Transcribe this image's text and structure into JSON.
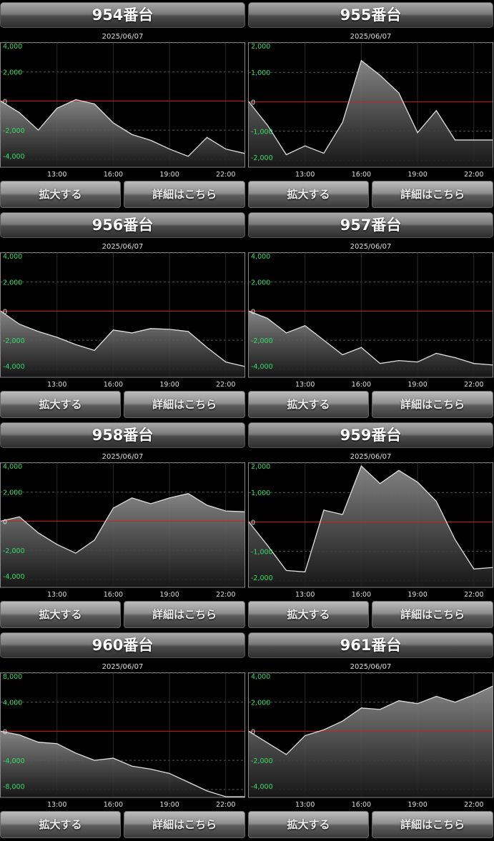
{
  "buttons": {
    "zoom_label": "拡大する",
    "detail_label": "詳細はこちら"
  },
  "colors": {
    "zero_line": "#cc2222",
    "axis_label": "#33dd66",
    "line": "#e0e0e0",
    "grid": "#555555"
  },
  "panels": [
    {
      "title": "954番台",
      "date": "2025/06/07"
    },
    {
      "title": "955番台",
      "date": "2025/06/07"
    },
    {
      "title": "956番台",
      "date": "2025/06/07"
    },
    {
      "title": "957番台",
      "date": "2025/06/07"
    },
    {
      "title": "958番台",
      "date": "2025/06/07"
    },
    {
      "title": "959番台",
      "date": "2025/06/07"
    },
    {
      "title": "960番台",
      "date": "2025/06/07"
    },
    {
      "title": "961番台",
      "date": "2025/06/07"
    }
  ],
  "chart_data": [
    {
      "type": "area",
      "x": [
        "10:00",
        "11:00",
        "12:00",
        "13:00",
        "14:00",
        "15:00",
        "16:00",
        "17:00",
        "18:00",
        "19:00",
        "20:00",
        "21:00",
        "22:00",
        "23:00"
      ],
      "xticks": [
        "13:00",
        "16:00",
        "19:00",
        "22:00"
      ],
      "ylim": [
        -4500,
        4000
      ],
      "yticks": [
        4000,
        2000,
        0,
        -2000,
        -4000
      ],
      "ytick_labels": [
        "4,000",
        "2,000",
        "0",
        "-2,000",
        "-4,000"
      ],
      "values": [
        0,
        -800,
        -2000,
        -500,
        100,
        -200,
        -1500,
        -2300,
        -2700,
        -3300,
        -3800,
        -2500,
        -3300,
        -3600
      ]
    },
    {
      "type": "area",
      "x": [
        "10:00",
        "11:00",
        "12:00",
        "13:00",
        "14:00",
        "15:00",
        "16:00",
        "17:00",
        "18:00",
        "19:00",
        "20:00",
        "21:00",
        "22:00",
        "23:00"
      ],
      "xticks": [
        "13:00",
        "16:00",
        "19:00",
        "22:00"
      ],
      "ylim": [
        -2200,
        2000
      ],
      "yticks": [
        2000,
        1000,
        0,
        -1000,
        -2000
      ],
      "ytick_labels": [
        "2,000",
        "1,000",
        "0",
        "-1,000",
        "-2,000"
      ],
      "values": [
        0,
        -800,
        -1800,
        -1500,
        -1750,
        -700,
        1400,
        900,
        300,
        -1050,
        -300,
        -1300,
        -1300,
        -1300
      ]
    },
    {
      "type": "area",
      "x": [
        "10:00",
        "11:00",
        "12:00",
        "13:00",
        "14:00",
        "15:00",
        "16:00",
        "17:00",
        "18:00",
        "19:00",
        "20:00",
        "21:00",
        "22:00",
        "23:00"
      ],
      "xticks": [
        "13:00",
        "16:00",
        "19:00",
        "22:00"
      ],
      "ylim": [
        -4500,
        4000
      ],
      "yticks": [
        4000,
        2000,
        0,
        -2000,
        -4000
      ],
      "ytick_labels": [
        "4,000",
        "2,000",
        "0",
        "-2,000",
        "-4,000"
      ],
      "values": [
        0,
        -900,
        -1400,
        -1800,
        -2300,
        -2700,
        -1300,
        -1500,
        -1200,
        -1250,
        -1400,
        -2500,
        -3500,
        -3800
      ]
    },
    {
      "type": "area",
      "x": [
        "10:00",
        "11:00",
        "12:00",
        "13:00",
        "14:00",
        "15:00",
        "16:00",
        "17:00",
        "18:00",
        "19:00",
        "20:00",
        "21:00",
        "22:00",
        "23:00"
      ],
      "xticks": [
        "13:00",
        "16:00",
        "19:00",
        "22:00"
      ],
      "ylim": [
        -4500,
        4000
      ],
      "yticks": [
        4000,
        2000,
        0,
        -2000,
        -4000
      ],
      "ytick_labels": [
        "4,000",
        "2,000",
        "0",
        "-2,000",
        "-4,000"
      ],
      "values": [
        0,
        -500,
        -1500,
        -1000,
        -2000,
        -3000,
        -2500,
        -3600,
        -3400,
        -3500,
        -2900,
        -3200,
        -3600,
        -3700
      ]
    },
    {
      "type": "area",
      "x": [
        "10:00",
        "11:00",
        "12:00",
        "13:00",
        "14:00",
        "15:00",
        "16:00",
        "17:00",
        "18:00",
        "19:00",
        "20:00",
        "21:00",
        "22:00",
        "23:00"
      ],
      "xticks": [
        "13:00",
        "16:00",
        "19:00",
        "22:00"
      ],
      "ylim": [
        -4500,
        4000
      ],
      "yticks": [
        4000,
        2000,
        0,
        -2000,
        -4000
      ],
      "ytick_labels": [
        "4,000",
        "2,000",
        "0",
        "-2,000",
        "-4,000"
      ],
      "values": [
        0,
        300,
        -800,
        -1600,
        -2200,
        -1300,
        900,
        1600,
        1200,
        1600,
        1900,
        1100,
        700,
        650
      ]
    },
    {
      "type": "area",
      "x": [
        "10:00",
        "11:00",
        "12:00",
        "13:00",
        "14:00",
        "15:00",
        "16:00",
        "17:00",
        "18:00",
        "19:00",
        "20:00",
        "21:00",
        "22:00",
        "23:00"
      ],
      "xticks": [
        "13:00",
        "16:00",
        "19:00",
        "22:00"
      ],
      "ylim": [
        -2200,
        2000
      ],
      "yticks": [
        2000,
        1000,
        0,
        -1000,
        -2000
      ],
      "ytick_labels": [
        "2,000",
        "1,000",
        "0",
        "-1,000",
        "-2,000"
      ],
      "values": [
        0,
        -800,
        -1650,
        -1700,
        400,
        250,
        1900,
        1300,
        1750,
        1350,
        700,
        -600,
        -1600,
        -1550
      ]
    },
    {
      "type": "area",
      "x": [
        "10:00",
        "11:00",
        "12:00",
        "13:00",
        "14:00",
        "15:00",
        "16:00",
        "17:00",
        "18:00",
        "19:00",
        "20:00",
        "21:00",
        "22:00",
        "23:00"
      ],
      "xticks": [
        "13:00",
        "16:00",
        "19:00",
        "22:00"
      ],
      "ylim": [
        -9000,
        8000
      ],
      "yticks": [
        8000,
        4000,
        0,
        -4000,
        -8000
      ],
      "ytick_labels": [
        "8,000",
        "4,000",
        "0",
        "-4,000",
        "-8,000"
      ],
      "values": [
        0,
        -500,
        -1500,
        -1700,
        -3000,
        -4000,
        -3700,
        -4800,
        -5200,
        -5800,
        -7000,
        -8200,
        -9000,
        -9000
      ]
    },
    {
      "type": "area",
      "x": [
        "10:00",
        "11:00",
        "12:00",
        "13:00",
        "14:00",
        "15:00",
        "16:00",
        "17:00",
        "18:00",
        "19:00",
        "20:00",
        "21:00",
        "22:00",
        "23:00"
      ],
      "xticks": [
        "13:00",
        "16:00",
        "19:00",
        "22:00"
      ],
      "ylim": [
        -4500,
        4000
      ],
      "yticks": [
        4000,
        2000,
        0,
        -2000,
        -4000
      ],
      "ytick_labels": [
        "4,000",
        "2,000",
        "0",
        "-2,000",
        "-4,000"
      ],
      "values": [
        0,
        -800,
        -1600,
        -300,
        100,
        700,
        1600,
        1500,
        2100,
        1900,
        2400,
        2000,
        2500,
        3100
      ]
    }
  ]
}
